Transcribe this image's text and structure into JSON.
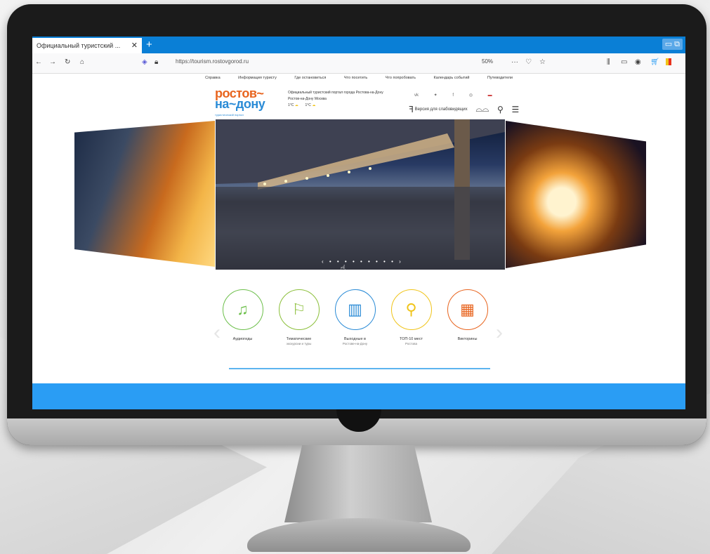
{
  "browser": {
    "tab_title": "Официальный туристский ...",
    "tab_close": "✕",
    "new_tab": "+",
    "url": "https://tourism.rostovgorod.ru",
    "zoom": "50%",
    "menu_dots": "···"
  },
  "site": {
    "nav": [
      "Справка",
      "Информация туристу",
      "Где остановиться",
      "Что посетить",
      "Что попробовать",
      "Календарь событий",
      "Путеводители"
    ],
    "logo_line1": "ростов~",
    "logo_line2": "на~дону",
    "logo_sub": "туристический портал",
    "header_text_1": "Официальный туристский портал города Ростова-на-Дону",
    "header_text_2": "Ростов-на-Дону  Москва",
    "temp_1": "1°C",
    "temp_2": "1°C",
    "accessibility_label": "Версия для слабовидящих"
  },
  "slider": {
    "dots": "‹ • • • • • • • • • ›"
  },
  "categories": [
    {
      "label": "Аудиогиды",
      "sub": "",
      "color": "#6cbf4a",
      "icon": "audio-guide-icon"
    },
    {
      "label": "Тематические",
      "sub": "экскурсии и туры",
      "color": "#8bbf3a",
      "icon": "tours-icon"
    },
    {
      "label": "Выходные в",
      "sub": "Ростове-на-Дону",
      "color": "#2a8bd6",
      "icon": "weekend-icon"
    },
    {
      "label": "ТОП-10 мест",
      "sub": "Ростова",
      "color": "#f0c419",
      "icon": "top10-icon"
    },
    {
      "label": "Викторины",
      "sub": "",
      "color": "#e8641e",
      "icon": "quiz-icon"
    }
  ]
}
